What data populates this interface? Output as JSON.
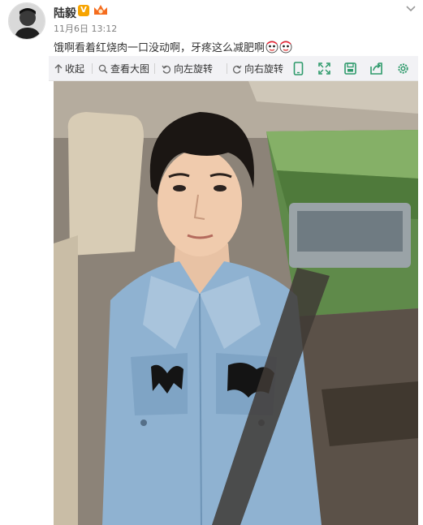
{
  "post": {
    "author": "陆毅",
    "verified_badge": "V",
    "time": "11月6日 13:12",
    "text": "饿啊看着红烧肉一口没动啊，牙疼这么减肥啊",
    "emoji_count": 2
  },
  "toolbar": {
    "collapse": "收起",
    "view_large": "查看大图",
    "rotate_left": "向左旋转",
    "rotate_right": "向右旋转",
    "right_icons": [
      "phone-icon",
      "fullscreen-icon",
      "save-icon",
      "share-icon",
      "settings-icon"
    ]
  },
  "colors": {
    "toolbar_bg": "#f2f2f5",
    "icon_green": "#2e9a6b",
    "badge_orange": "#f7a400",
    "time_gray": "#808080"
  }
}
